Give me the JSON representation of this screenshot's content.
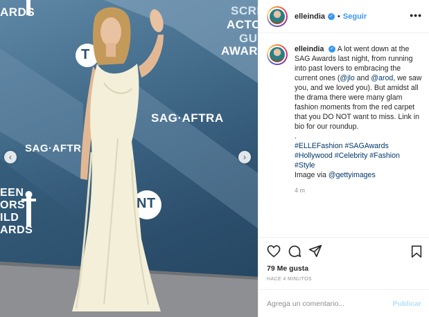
{
  "post": {
    "media": {
      "alt_subject": "Woman in white satin gown on SAG Awards red carpet",
      "wall_texts": {
        "top_left": "ARDS",
        "top_right_1": "SCRE",
        "top_right_2": "ACTO",
        "top_right_3": "GU",
        "top_right_4": "AWARDS",
        "sag_aftra_main": "SAG·AFTRA",
        "sag_aftra_left": "SAG·AFTR",
        "bottom_left_1": "EEN",
        "bottom_left_2": "ORS",
        "bottom_left_3": "ILD",
        "bottom_left_4": "ARDS",
        "tnt_top": "T",
        "tnt_bottom": "NT"
      },
      "prev_icon": "chevron-left-icon",
      "next_icon": "chevron-right-icon"
    },
    "header": {
      "username": "elleindia",
      "verified": "✓",
      "separator": "•",
      "follow_label": "Seguir",
      "more_icon": "•••"
    },
    "caption": {
      "username": "elleindia",
      "text_1": "A lot went down at the SAG Awards last night, from running into past lovers to embracing the current ones (",
      "mention_1": "@jlo",
      "text_2": " and ",
      "mention_2": "@arod",
      "text_3": ", we saw you, and we loved you). But amidst all the drama there were many glam fashion moments from the red carpet that you DO NOT want to miss. Link in bio for our roundup.",
      "dot": ".",
      "hashtags_1": "#ELLEFashion #SAGAwards",
      "hashtags_2": "#Hollywood #Celebrity #Fashion",
      "hashtags_3": "#Style",
      "image_via": "Image via ",
      "image_via_mention": "@gettyimages",
      "time": "4 m"
    },
    "likes_text": "79 Me gusta",
    "ago_text": "HACE 4 MINUTOS",
    "comment": {
      "placeholder": "Agrega un comentario...",
      "publish_label": "Publicar"
    },
    "colors": {
      "accent": "#3897f0",
      "link": "#00376b",
      "muted": "#8e8e8e",
      "publish_disabled": "#b2dffc"
    }
  }
}
